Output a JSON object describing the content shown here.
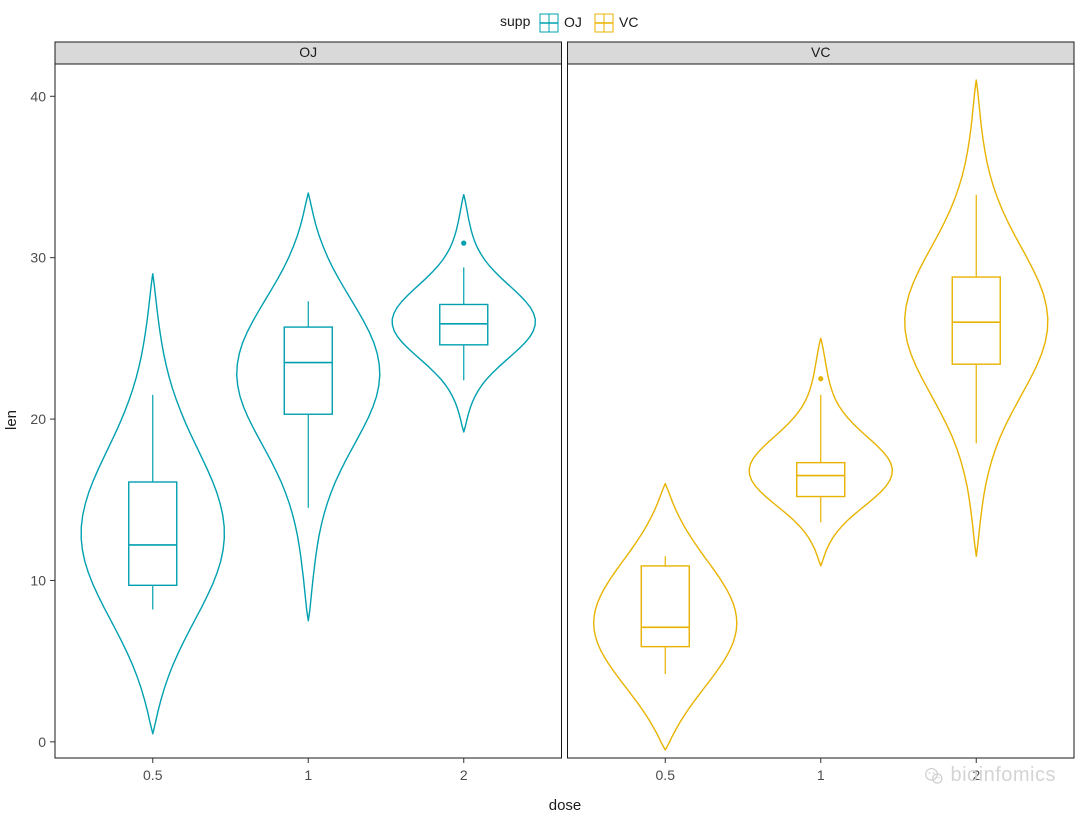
{
  "legend": {
    "title": "supp",
    "items": [
      "OJ",
      "VC"
    ]
  },
  "colors": {
    "OJ": "#00a0b0",
    "VC": "#e8b300"
  },
  "facets": [
    "OJ",
    "VC"
  ],
  "axes": {
    "x": {
      "title": "dose",
      "ticks": [
        "0.5",
        "1",
        "2"
      ]
    },
    "y": {
      "title": "len",
      "ticks": [
        0,
        10,
        20,
        30,
        40
      ],
      "range": [
        -1,
        42
      ]
    }
  },
  "watermark": "bioinfomics",
  "chart_data": {
    "type": "boxplot-violin",
    "xlabel": "dose",
    "ylabel": "len",
    "legend_title": "supp",
    "facet_by": "supp",
    "ylim": [
      -1,
      42
    ],
    "series": [
      {
        "name": "OJ",
        "categories": [
          "0.5",
          "1",
          "2"
        ],
        "box": [
          {
            "min": 8.2,
            "q1": 9.7,
            "median": 12.2,
            "q3": 16.1,
            "max": 21.5,
            "outliers": []
          },
          {
            "min": 14.5,
            "q1": 20.3,
            "median": 23.5,
            "q3": 25.7,
            "max": 27.3,
            "outliers": []
          },
          {
            "min": 22.4,
            "q1": 24.6,
            "median": 25.9,
            "q3": 27.1,
            "max": 29.4,
            "outliers": [
              30.9
            ]
          }
        ],
        "violin_extent": [
          {
            "low": 0.5,
            "high": 29.0
          },
          {
            "low": 7.5,
            "high": 34.0
          },
          {
            "low": 19.2,
            "high": 33.9
          }
        ]
      },
      {
        "name": "VC",
        "categories": [
          "0.5",
          "1",
          "2"
        ],
        "box": [
          {
            "min": 4.2,
            "q1": 5.9,
            "median": 7.1,
            "q3": 10.9,
            "max": 11.5,
            "outliers": []
          },
          {
            "min": 13.6,
            "q1": 15.2,
            "median": 16.5,
            "q3": 17.3,
            "max": 21.5,
            "outliers": [
              22.5
            ]
          },
          {
            "min": 18.5,
            "q1": 23.4,
            "median": 26.0,
            "q3": 28.8,
            "max": 33.9,
            "outliers": []
          }
        ],
        "violin_extent": [
          {
            "low": -0.5,
            "high": 16.0
          },
          {
            "low": 10.9,
            "high": 25.0
          },
          {
            "low": 11.5,
            "high": 41.0
          }
        ]
      }
    ]
  }
}
